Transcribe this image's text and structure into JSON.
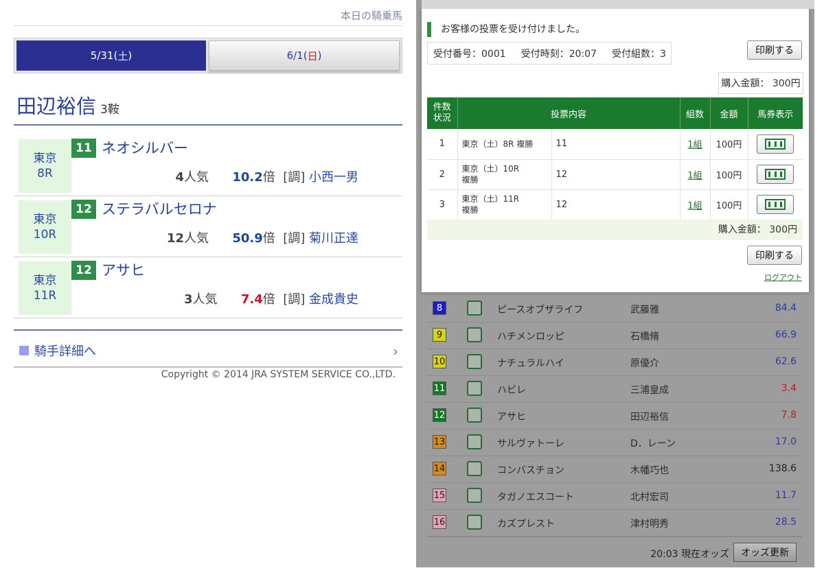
{
  "left": {
    "top_link": "本日の騎乗馬",
    "tabs": [
      {
        "date": "5/31(",
        "day": "土",
        "close": ")"
      },
      {
        "date": "6/1(",
        "day": "日",
        "close": ")"
      }
    ],
    "jockey_name": "田辺裕信",
    "rides": "3鞍",
    "races": [
      {
        "venue": "東京",
        "race": "8R",
        "num": "11",
        "horse": "ネオシルバー",
        "pop_num": "4",
        "pop_label": "人気",
        "odds": "10.2",
        "odds_unit": "倍",
        "trainer_tag": "[調]",
        "trainer": "小西一男"
      },
      {
        "venue": "東京",
        "race": "10R",
        "num": "12",
        "horse": "ステラバルセロナ",
        "pop_num": "12",
        "pop_label": "人気",
        "odds": "50.9",
        "odds_unit": "倍",
        "trainer_tag": "[調]",
        "trainer": "菊川正達"
      },
      {
        "venue": "東京",
        "race": "11R",
        "num": "12",
        "horse": "アサヒ",
        "pop_num": "3",
        "pop_label": "人気",
        "odds": "7.4",
        "odds_unit": "倍",
        "trainer_tag": "[調]",
        "trainer": "金成貴史"
      }
    ],
    "detail_link": "騎手詳細へ",
    "chevron": "›",
    "copyright": "Copyright © 2014 JRA SYSTEM SERVICE CO.,LTD."
  },
  "modal": {
    "message": "お客様の投票を受け付けました。",
    "receipt_no_label": "受付番号：",
    "receipt_no": "0001",
    "receipt_time_label": "受付時刻：",
    "receipt_time": "20:07",
    "receipt_sets_label": "受付組数：",
    "receipt_sets": "3",
    "print_label": "印刷する",
    "amount_label": "購入金額：",
    "amount": "300円",
    "table_headers": {
      "status": "件数\n状況",
      "content": "投票内容",
      "sets": "組数",
      "money": "金額",
      "ticket": "馬券表示"
    },
    "bets": [
      {
        "no": "1",
        "content": "東京（土）8R 複勝",
        "horse": "11",
        "sets": "1組",
        "money": "100円"
      },
      {
        "no": "2",
        "content": "東京（土）10R\n複勝",
        "horse": "12",
        "sets": "1組",
        "money": "100円"
      },
      {
        "no": "3",
        "content": "東京（土）11R\n複勝",
        "horse": "12",
        "sets": "1組",
        "money": "100円"
      }
    ],
    "total_label": "購入金額：",
    "total": "300円",
    "logout": "ログアウト"
  },
  "odds_list": [
    {
      "num": "8",
      "color": "#1c1cc9",
      "text_color": "#ffffff",
      "name": "ピースオブザライフ",
      "jockey": "武藤雅",
      "odds": "84.4",
      "odds_color": "blue"
    },
    {
      "num": "9",
      "color": "#d8d21a",
      "text_color": "#222222",
      "name": "ハチメンロッピ",
      "jockey": "石橋脩",
      "odds": "66.9",
      "odds_color": "blue"
    },
    {
      "num": "10",
      "color": "#d8d21a",
      "text_color": "#222222",
      "name": "ナチュラルハイ",
      "jockey": "原優介",
      "odds": "62.6",
      "odds_color": "blue"
    },
    {
      "num": "11",
      "color": "#137a23",
      "text_color": "#ffffff",
      "name": "ハビレ",
      "jockey": "三浦皇成",
      "odds": "3.4",
      "odds_color": "red"
    },
    {
      "num": "12",
      "color": "#137a23",
      "text_color": "#ffffff",
      "name": "アサヒ",
      "jockey": "田辺裕信",
      "odds": "7.8",
      "odds_color": "red"
    },
    {
      "num": "13",
      "color": "#d58a1a",
      "text_color": "#222222",
      "name": "サルヴァトーレ",
      "jockey": "D．レーン",
      "odds": "17.0",
      "odds_color": "blue"
    },
    {
      "num": "14",
      "color": "#d58a1a",
      "text_color": "#222222",
      "name": "コンバスチョン",
      "jockey": "木幡巧也",
      "odds": "138.6",
      "odds_color": "black"
    },
    {
      "num": "15",
      "color": "#e7a0b4",
      "text_color": "#222222",
      "name": "タガノエスコート",
      "jockey": "北村宏司",
      "odds": "11.7",
      "odds_color": "blue"
    },
    {
      "num": "16",
      "color": "#e7a0b4",
      "text_color": "#222222",
      "name": "カズプレスト",
      "jockey": "津村明秀",
      "odds": "28.5",
      "odds_color": "blue"
    }
  ],
  "odds_footer": {
    "time": "20:03 現在オッズ",
    "update": "オッズ更新"
  }
}
